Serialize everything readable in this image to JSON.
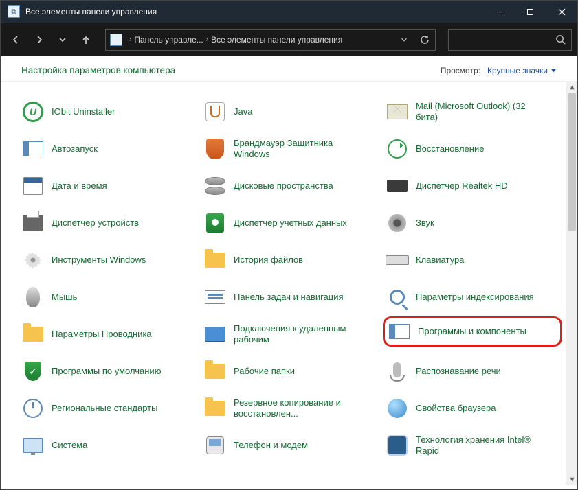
{
  "window": {
    "title": "Все элементы панели управления"
  },
  "breadcrumb": {
    "seg1": "Панель управле...",
    "seg2": "Все элементы панели управления"
  },
  "header": {
    "title": "Настройка параметров компьютера",
    "view_label": "Просмотр:",
    "view_value": "Крупные значки"
  },
  "items": [
    {
      "label": "IObit Uninstaller",
      "icon": "iobit"
    },
    {
      "label": "Java",
      "icon": "java"
    },
    {
      "label": "Mail (Microsoft Outlook) (32 бита)",
      "icon": "mail"
    },
    {
      "label": "Автозапуск",
      "icon": "panel"
    },
    {
      "label": "Брандмауэр Защитника Windows",
      "icon": "shield"
    },
    {
      "label": "Восстановление",
      "icon": "recover"
    },
    {
      "label": "Дата и время",
      "icon": "cal"
    },
    {
      "label": "Дисковые пространства",
      "icon": "disks"
    },
    {
      "label": "Диспетчер Realtek HD",
      "icon": "audio"
    },
    {
      "label": "Диспетчер устройств",
      "icon": "printer"
    },
    {
      "label": "Диспетчер учетных данных",
      "icon": "safe"
    },
    {
      "label": "Звук",
      "icon": "speaker"
    },
    {
      "label": "Инструменты Windows",
      "icon": "gear"
    },
    {
      "label": "История файлов",
      "icon": "folder"
    },
    {
      "label": "Клавиатура",
      "icon": "keyb"
    },
    {
      "label": "Мышь",
      "icon": "mouse"
    },
    {
      "label": "Панель задач и навигация",
      "icon": "card"
    },
    {
      "label": "Параметры индексирования",
      "icon": "magnify"
    },
    {
      "label": "Параметры Проводника",
      "icon": "folder"
    },
    {
      "label": "Подключения к удаленным рабочим",
      "icon": "desk"
    },
    {
      "label": "Программы и компоненты",
      "icon": "panel",
      "highlight": true
    },
    {
      "label": "Программы по умолчанию",
      "icon": "green"
    },
    {
      "label": "Рабочие папки",
      "icon": "folder"
    },
    {
      "label": "Распознавание речи",
      "icon": "mic"
    },
    {
      "label": "Региональные стандарты",
      "icon": "clock"
    },
    {
      "label": "Резервное копирование и восстановлен...",
      "icon": "folder"
    },
    {
      "label": "Свойства браузера",
      "icon": "globe"
    },
    {
      "label": "Система",
      "icon": "monitor"
    },
    {
      "label": "Телефон и модем",
      "icon": "phone"
    },
    {
      "label": "Технология хранения Intel® Rapid",
      "icon": "chip"
    }
  ]
}
